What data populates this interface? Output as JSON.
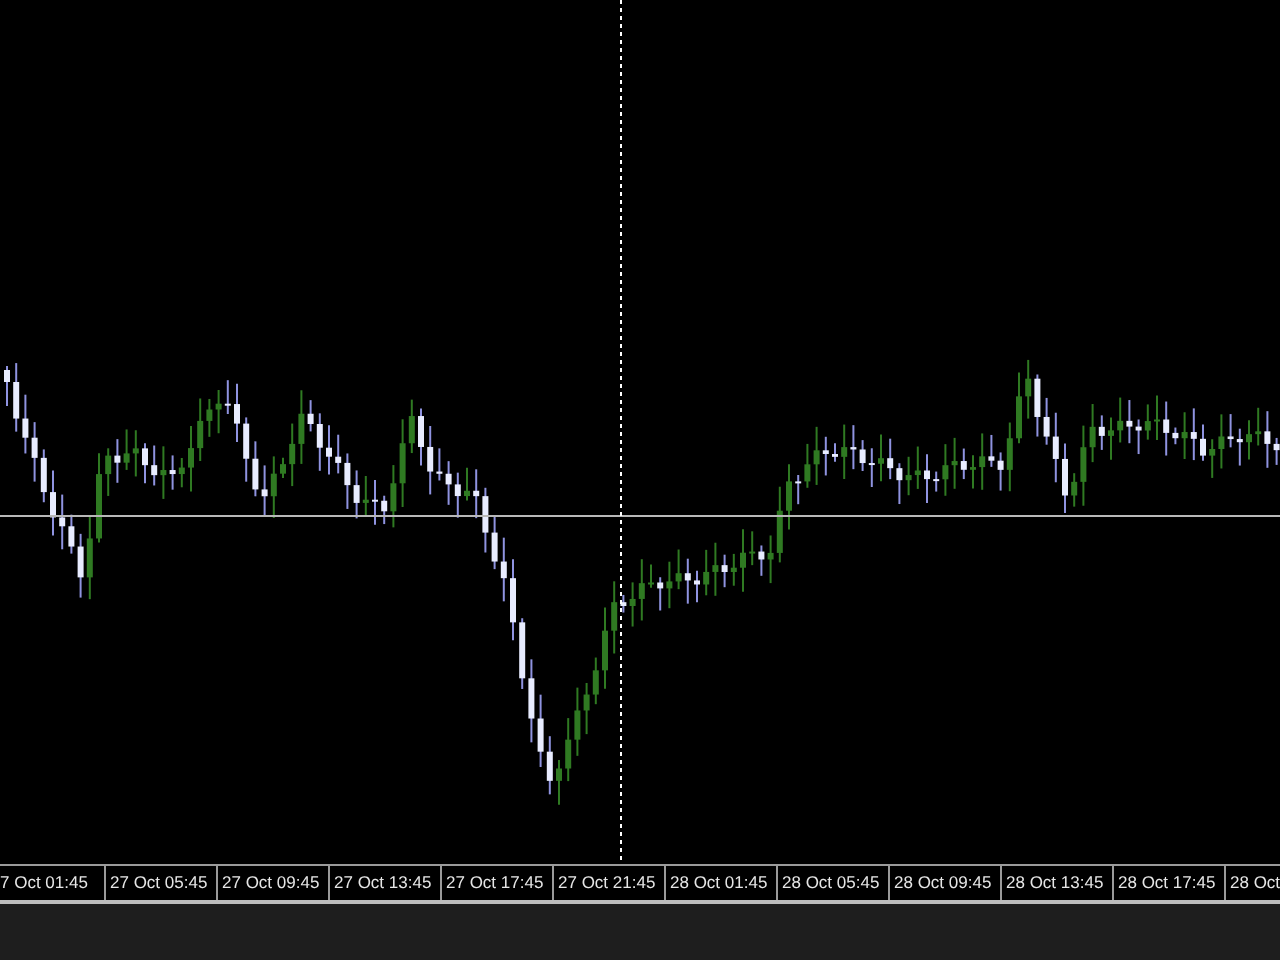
{
  "time_axis": {
    "labels": [
      "7 Oct 01:45",
      "27 Oct 05:45",
      "27 Oct 09:45",
      "27 Oct 13:45",
      "27 Oct 17:45",
      "27 Oct 21:45",
      "28 Oct 01:45",
      "28 Oct 05:45",
      "28 Oct 09:45",
      "28 Oct 13:45",
      "28 Oct 17:45",
      "28 Oct"
    ]
  }
}
